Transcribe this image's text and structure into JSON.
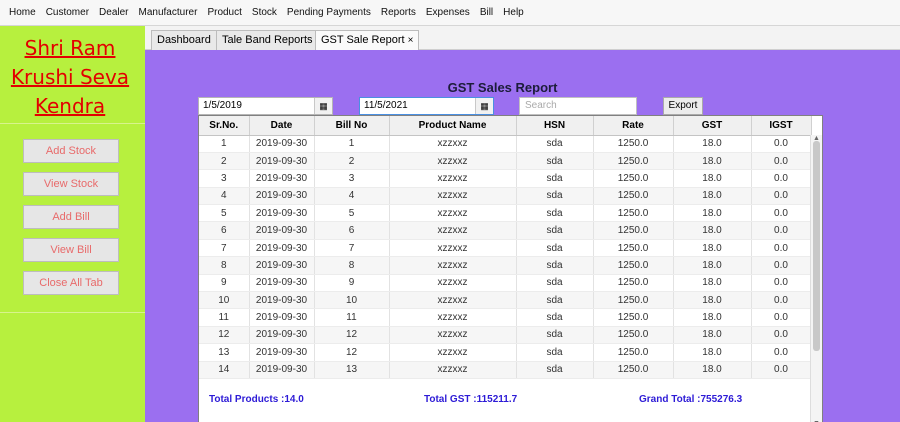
{
  "menu": [
    "Home",
    "Customer",
    "Dealer",
    "Manufacturer",
    "Product",
    "Stock",
    "Pending Payments",
    "Reports",
    "Expenses",
    "Bill",
    "Help"
  ],
  "brand": {
    "line1": "Shri Ram",
    "line2": "Krushi Seva",
    "line3": "Kendra",
    "color": "#e30000"
  },
  "sidebar_buttons": [
    "Add Stock",
    "View Stock",
    "Add Bill",
    "View Bill",
    "Close All Tab"
  ],
  "tabs": [
    "Dashboard",
    "Tale Band Reports",
    "GST Sale Report"
  ],
  "tab_close_icon": "×",
  "report": {
    "title": "GST Sales Report",
    "from_date": "1/5/2019",
    "to_date": "11/5/2021",
    "search_placeholder": "Search",
    "export_label": "Export"
  },
  "table": {
    "columns": [
      "Sr.No.",
      "Date",
      "Bill No",
      "Product Name",
      "HSN",
      "Rate",
      "GST",
      "IGST"
    ],
    "rows": [
      [
        "1",
        "2019-09-30",
        "1",
        "xzzxxz",
        "sda",
        "1250.0",
        "18.0",
        "0.0"
      ],
      [
        "2",
        "2019-09-30",
        "2",
        "xzzxxz",
        "sda",
        "1250.0",
        "18.0",
        "0.0"
      ],
      [
        "3",
        "2019-09-30",
        "3",
        "xzzxxz",
        "sda",
        "1250.0",
        "18.0",
        "0.0"
      ],
      [
        "4",
        "2019-09-30",
        "4",
        "xzzxxz",
        "sda",
        "1250.0",
        "18.0",
        "0.0"
      ],
      [
        "5",
        "2019-09-30",
        "5",
        "xzzxxz",
        "sda",
        "1250.0",
        "18.0",
        "0.0"
      ],
      [
        "6",
        "2019-09-30",
        "6",
        "xzzxxz",
        "sda",
        "1250.0",
        "18.0",
        "0.0"
      ],
      [
        "7",
        "2019-09-30",
        "7",
        "xzzxxz",
        "sda",
        "1250.0",
        "18.0",
        "0.0"
      ],
      [
        "8",
        "2019-09-30",
        "8",
        "xzzxxz",
        "sda",
        "1250.0",
        "18.0",
        "0.0"
      ],
      [
        "9",
        "2019-09-30",
        "9",
        "xzzxxz",
        "sda",
        "1250.0",
        "18.0",
        "0.0"
      ],
      [
        "10",
        "2019-09-30",
        "10",
        "xzzxxz",
        "sda",
        "1250.0",
        "18.0",
        "0.0"
      ],
      [
        "11",
        "2019-09-30",
        "11",
        "xzzxxz",
        "sda",
        "1250.0",
        "18.0",
        "0.0"
      ],
      [
        "12",
        "2019-09-30",
        "12",
        "xzzxxz",
        "sda",
        "1250.0",
        "18.0",
        "0.0"
      ],
      [
        "13",
        "2019-09-30",
        "12",
        "xzzxxz",
        "sda",
        "1250.0",
        "18.0",
        "0.0"
      ],
      [
        "14",
        "2019-09-30",
        "13",
        "xzzxxz",
        "sda",
        "1250.0",
        "18.0",
        "0.0"
      ]
    ]
  },
  "totals": {
    "products": "Total Products :14.0",
    "gst": "Total GST :115211.7",
    "grand": "Grand Total :755276.3"
  },
  "colors": {
    "sidebar": "#b7f03e",
    "content": "#9b6ff0",
    "totals_text": "#2d1bd6"
  }
}
